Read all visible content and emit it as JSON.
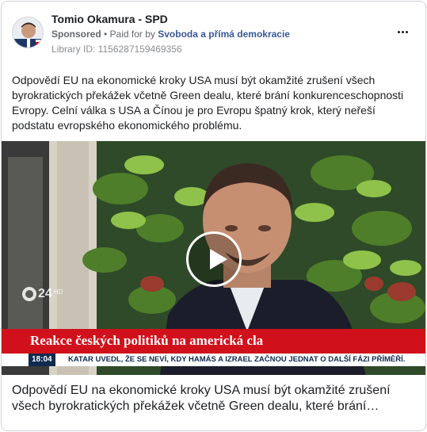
{
  "post": {
    "page_name": "Tomio Okamura - SPD",
    "sponsored_label": "Sponsored",
    "separator": " • ",
    "paid_for_label": "Paid for by ",
    "payer": "Svoboda a přímá demokracie",
    "library_id": "Library ID: 1156287159469356",
    "body_text": "Odpovědí EU na ekonomické kroky USA musí být okamžité zrušení všech byrokratických překážek včetně Green dealu, které brání konkurenceschopnosti Evropy. Celní válka s USA a Čínou je pro Evropu špatný krok, který neřeší podstatu evropského ekonomického problému.",
    "more_icon": "more-horizontal-icon"
  },
  "video": {
    "channel_logo": "24",
    "channel_logo_suffix": "HD",
    "caption": "Reakce českých politiků na americká cla",
    "ticker_time": "18:04",
    "ticker_text": "KATAR UVEDL, ŽE SE NEVÍ, KDY HAMÁS A IZRAEL ZAČNOU JEDNAT O DALŠÍ FÁZI PŘÍMĚŘÍ.",
    "play_icon": "play-icon",
    "accent_color": "#d0111b"
  },
  "link": {
    "text": "Odpovědí EU na ekonomické kroky USA musí být okamžité zrušení všech byrokratických překážek včetně Green dealu, které brání…"
  }
}
